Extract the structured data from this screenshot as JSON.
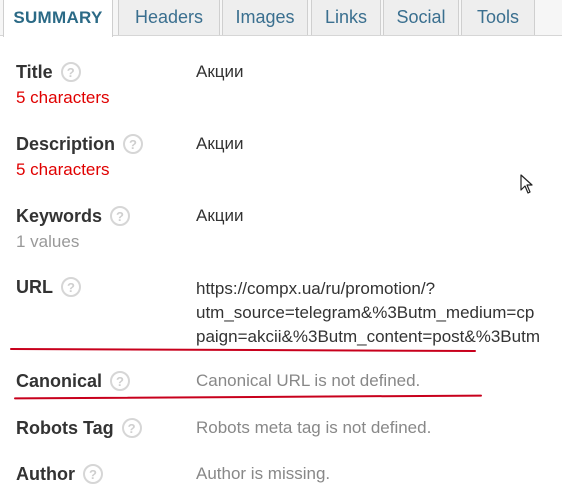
{
  "tabs": [
    {
      "label": "SUMMARY",
      "active": true
    },
    {
      "label": "Headers"
    },
    {
      "label": "Images"
    },
    {
      "label": "Links"
    },
    {
      "label": "Social"
    },
    {
      "label": "Tools"
    }
  ],
  "rows": {
    "title": {
      "label": "Title",
      "sub": "5 characters",
      "value": "Акции"
    },
    "description": {
      "label": "Description",
      "sub": "5 characters",
      "value": "Акции"
    },
    "keywords": {
      "label": "Keywords",
      "sub": "1 values",
      "value": "Акции"
    },
    "url": {
      "label": "URL",
      "value_lines": [
        "https://compx.ua/ru/promotion/?",
        "utm_source=telegram&%3Butm_medium=cp",
        "paign=akcii&%3Butm_content=post&%3Butm"
      ]
    },
    "canonical": {
      "label": "Canonical",
      "value": "Canonical URL is not defined."
    },
    "robots": {
      "label": "Robots Tag",
      "value": "Robots meta tag is not defined."
    },
    "author": {
      "label": "Author",
      "value": "Author is missing."
    }
  },
  "help_icon_glyph": "?",
  "colors": {
    "accent": "#2b6a86",
    "warning": "#e00000",
    "annotation": "#c8001c"
  }
}
